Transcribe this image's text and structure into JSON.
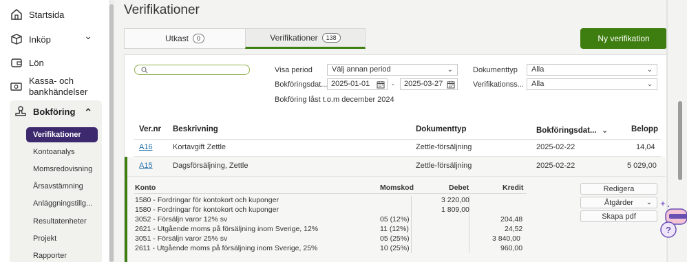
{
  "sidebar": {
    "items": [
      {
        "label": "Startsida",
        "icon": "home-icon"
      },
      {
        "label": "Inköp",
        "icon": "box-icon",
        "has_chevron": true
      },
      {
        "label": "Lön",
        "icon": "wallet-icon"
      },
      {
        "label": "Kassa- och bankhändelser",
        "label_line1": "Kassa- och",
        "label_line2": "bankhändelser",
        "icon": "cash-icon"
      },
      {
        "label": "Bokföring",
        "icon": "stamp-icon",
        "expanded": true
      }
    ],
    "chevron_down": "⌄",
    "chevron_up": "⌃",
    "sub_items": [
      "Verifikationer",
      "Kontoanalys",
      "Momsredovisning",
      "Årsavstämning",
      "Anläggningstillg...",
      "Resultatenheter",
      "Projekt",
      "Rapporter"
    ],
    "active_sub_item": "Verifikationer"
  },
  "page": {
    "title": "Verifikationer"
  },
  "tabs": [
    {
      "label": "Utkast",
      "count": "0",
      "active": false
    },
    {
      "label": "Verifikationer",
      "count": "138",
      "active": true
    }
  ],
  "new_button": {
    "label": "Ny verifikation"
  },
  "filters": {
    "search_placeholder": "",
    "visa_period_label": "Visa period",
    "visa_period_value": "Välj annan period",
    "bokforingsdatum_label": "Bokföringsdat...",
    "date_from": "2025-01-01",
    "date_separator": "-",
    "date_to": "2025-03-27",
    "dokumenttyp_label": "Dokumenttyp",
    "dokumenttyp_value": "Alla",
    "verifikationsserie_label": "Verifikationss...",
    "verifikationsserie_value": "Alla",
    "locked_note": "Bokföring låst t.o.m december 2024"
  },
  "table": {
    "headers": {
      "vernr": "Ver.nr",
      "beskrivning": "Beskrivning",
      "dokumenttyp": "Dokumenttyp",
      "bokforingsdatum": "Bokföringsdat...",
      "belopp": "Belopp"
    },
    "sort_indicator": "⌄",
    "rows": [
      {
        "vernr": "A16",
        "beskrivning": "Kortavgift Zettle",
        "dokumenttyp": "Zettle-försäljning",
        "datum": "2025-02-22",
        "belopp": "14,04"
      },
      {
        "vernr": "A15",
        "beskrivning": "Dagsförsäljning, Zettle",
        "dokumenttyp": "Zettle-försäljning",
        "datum": "2025-02-22",
        "belopp": "5 029,00",
        "expanded": true
      }
    ]
  },
  "detail": {
    "headers": {
      "konto": "Konto",
      "momskod": "Momskod",
      "debet": "Debet",
      "kredit": "Kredit"
    },
    "lines": [
      {
        "konto": "1580 - Fordringar för kontokort och kuponger",
        "momskod": "",
        "debet": "3 220,00",
        "kredit": ""
      },
      {
        "konto": "1580 - Fordringar för kontokort och kuponger",
        "momskod": "",
        "debet": "1 809,00",
        "kredit": ""
      },
      {
        "konto": "3052 - Försäljn varor 12% sv",
        "momskod": "05 (12%)",
        "debet": "",
        "kredit": "204,48"
      },
      {
        "konto": "2621 - Utgående moms på försäljning inom Sverige, 12%",
        "momskod": "11 (12%)",
        "debet": "",
        "kredit": "24,52"
      },
      {
        "konto": "3051 - Försäljn varor 25% sv",
        "momskod": "05 (25%)",
        "debet": "",
        "kredit": "3 840,00"
      },
      {
        "konto": "2611 - Utgående moms på försäljning inom Sverige, 25%",
        "momskod": "10 (25%)",
        "debet": "",
        "kredit": "960,00"
      }
    ],
    "actions": {
      "edit": "Redigera",
      "actions": "Åtgärder",
      "pdf": "Skapa pdf"
    }
  },
  "colors": {
    "accent_green": "#3e7d0f",
    "active_nav": "#3d2a6e",
    "link_blue": "#1f6fa8",
    "search_border": "#8fb04a"
  }
}
